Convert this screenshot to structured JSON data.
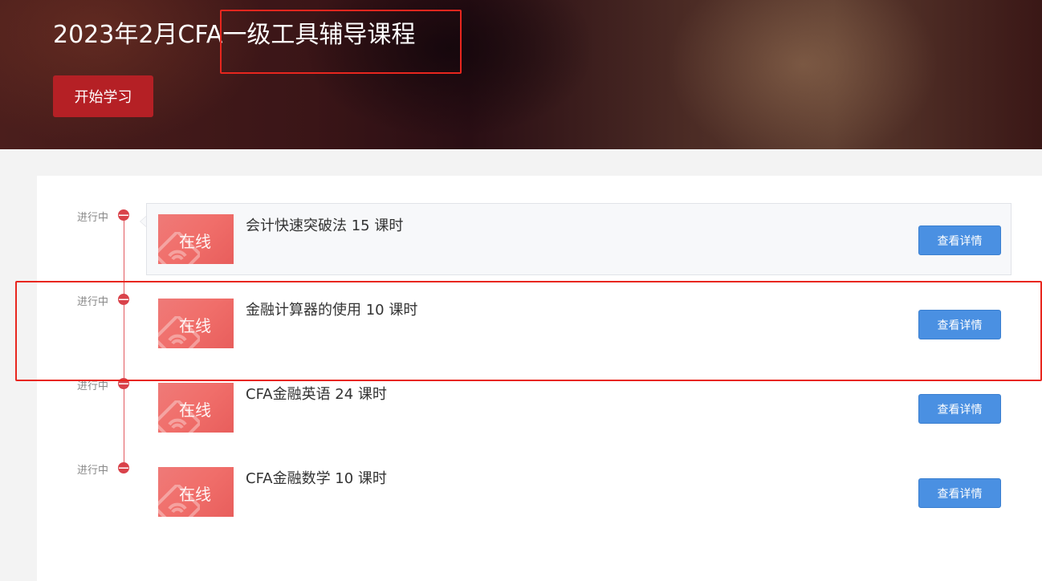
{
  "hero": {
    "title": "2023年2月CFA一级工具辅导课程",
    "start_button": "开始学习"
  },
  "courses": [
    {
      "status": "进行中",
      "thumb_label": "在线",
      "title": "会计快速突破法 15 课时",
      "detail_button": "查看详情",
      "selected": true
    },
    {
      "status": "进行中",
      "thumb_label": "在线",
      "title": "金融计算器的使用 10 课时",
      "detail_button": "查看详情",
      "selected": false
    },
    {
      "status": "进行中",
      "thumb_label": "在线",
      "title": "CFA金融英语 24 课时",
      "detail_button": "查看详情",
      "selected": false
    },
    {
      "status": "进行中",
      "thumb_label": "在线",
      "title": "CFA金融数学 10 课时",
      "detail_button": "查看详情",
      "selected": false
    }
  ],
  "colors": {
    "brand_red": "#b52025",
    "timeline_red": "#d9424a",
    "thumb_red": "#f06e6a",
    "button_blue": "#4a90e2",
    "annotation_red": "#e8261e"
  }
}
